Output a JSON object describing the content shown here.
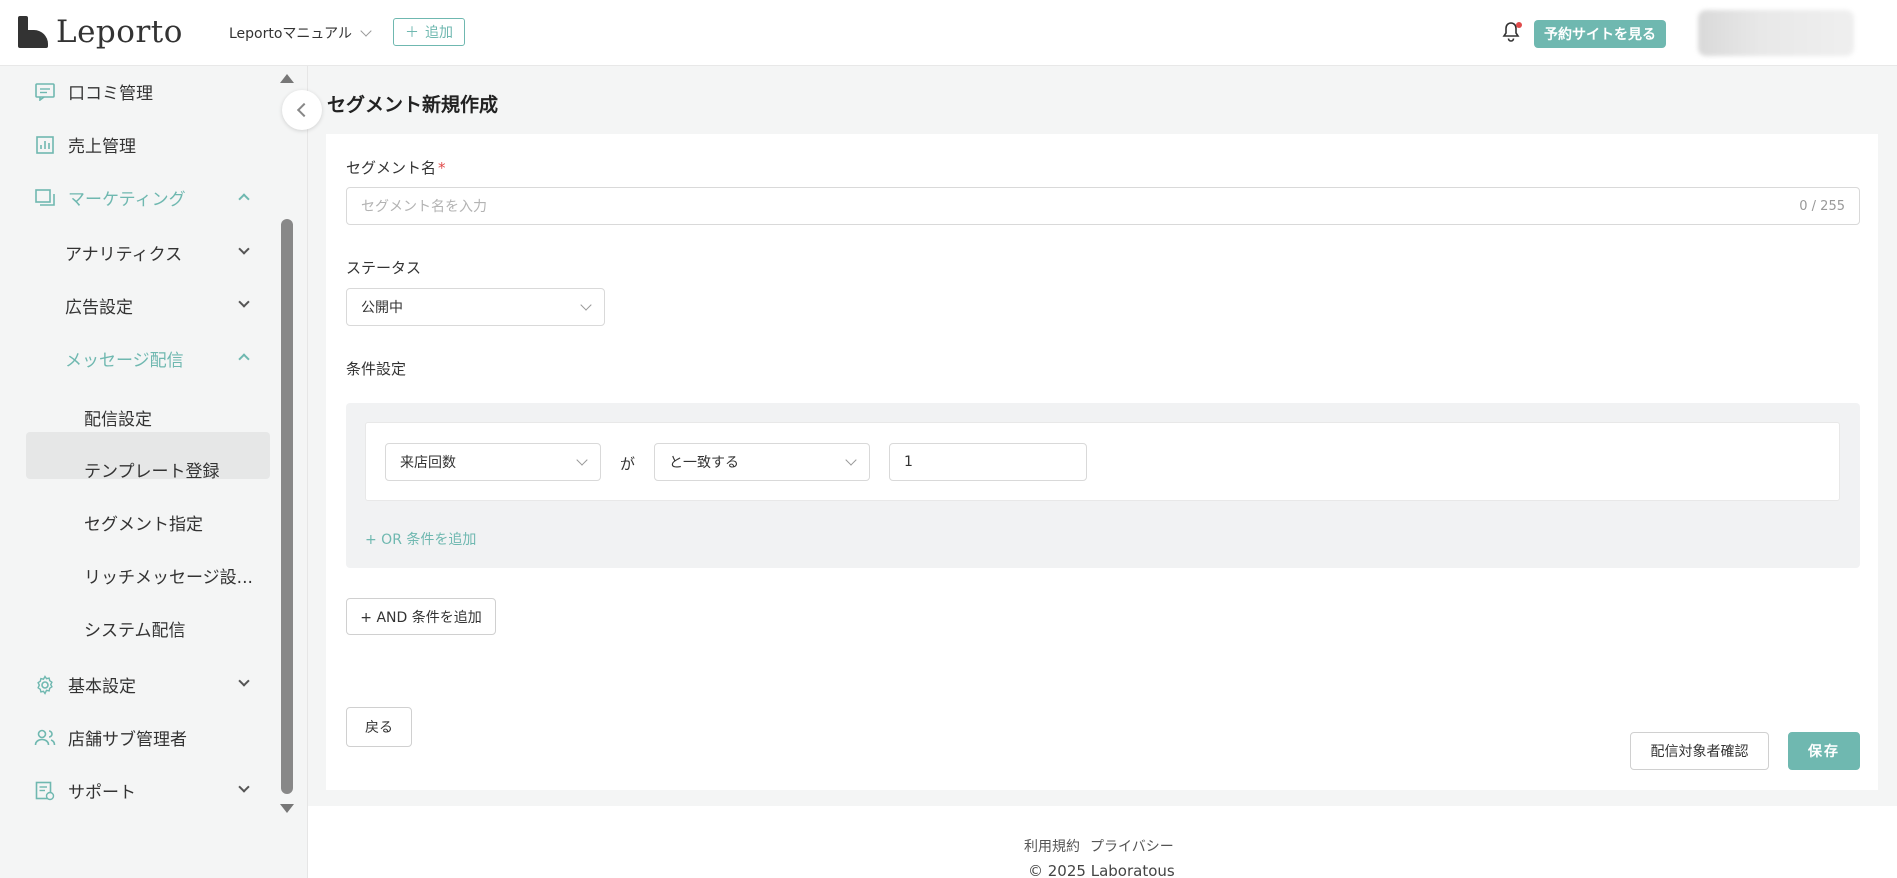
{
  "header": {
    "logo_text": "Leporto",
    "manual_select": "Leportoマニュアル",
    "add_button": "追加",
    "site_button": "予約サイトを見る"
  },
  "sidebar": {
    "items": [
      {
        "label": "口コミ管理",
        "icon": "chat-icon"
      },
      {
        "label": "売上管理",
        "icon": "chart-icon"
      },
      {
        "label": "マーケティング",
        "icon": "marketing-icon"
      },
      {
        "label": "アナリティクス"
      },
      {
        "label": "広告設定"
      },
      {
        "label": "メッセージ配信"
      },
      {
        "label": "配信設定"
      },
      {
        "label": "テンプレート登録"
      },
      {
        "label": "セグメント指定"
      },
      {
        "label": "リッチメッセージ設..."
      },
      {
        "label": "システム配信"
      },
      {
        "label": "基本設定",
        "icon": "gear-icon"
      },
      {
        "label": "店舗サブ管理者",
        "icon": "users-icon"
      },
      {
        "label": "サポート",
        "icon": "support-icon"
      }
    ]
  },
  "main": {
    "title": "セグメント新規作成",
    "segment_name_label": "セグメント名",
    "required_mark": "*",
    "segment_name_placeholder": "セグメント名を入力",
    "segment_name_count": "0 / 255",
    "status_label": "ステータス",
    "status_value": "公開中",
    "condition_label": "条件設定",
    "condition": {
      "field": "来店回数",
      "connector": "が",
      "operator": "と一致する",
      "value": "1"
    },
    "or_add": "+ OR 条件を追加",
    "and_add": "+ AND 条件を追加",
    "back_button": "戻る",
    "confirm_button": "配信対象者確認",
    "save_button": "保存"
  },
  "footer": {
    "terms": "利用規約",
    "privacy": "プライバシー",
    "copyright": "© 2025 Laboratous"
  },
  "colors": {
    "accent": "#6fb8b0",
    "required": "#e04b4b"
  }
}
